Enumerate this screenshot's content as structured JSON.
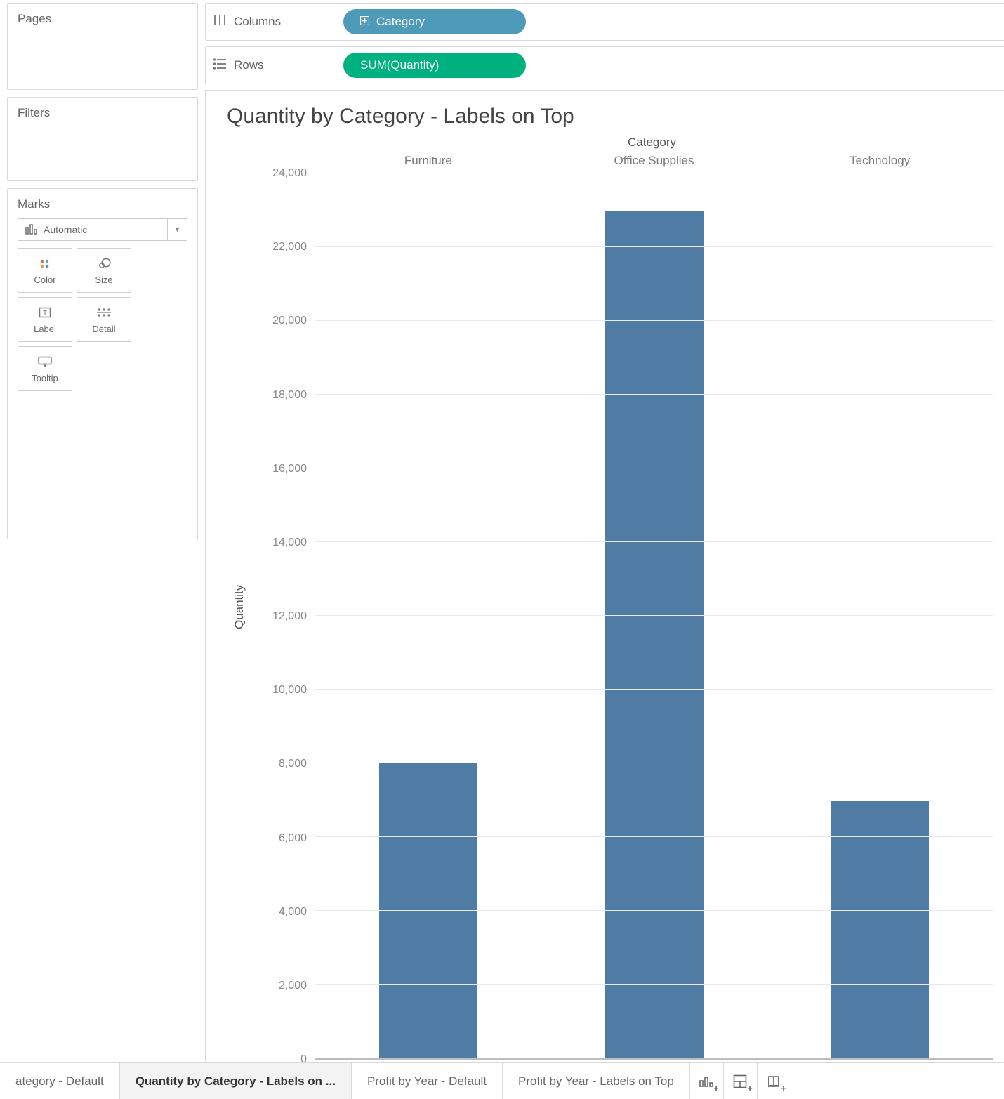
{
  "shelves": {
    "pages_label": "Pages",
    "filters_label": "Filters",
    "marks_label": "Marks",
    "columns_label": "Columns",
    "rows_label": "Rows"
  },
  "marks_card": {
    "dropdown_label": "Automatic",
    "buttons": {
      "color": "Color",
      "size": "Size",
      "label": "Label",
      "detail": "Detail",
      "tooltip": "Tooltip"
    }
  },
  "pills": {
    "columns": "Category",
    "rows": "SUM(Quantity)"
  },
  "viz": {
    "title": "Quantity by Category - Labels on Top",
    "x_dim_label": "Category",
    "y_measure_label": "Quantity"
  },
  "chart_data": {
    "type": "bar",
    "categories": [
      "Furniture",
      "Office Supplies",
      "Technology"
    ],
    "values": [
      8000,
      23000,
      7000
    ],
    "title": "Quantity by Category - Labels on Top",
    "xlabel": "Category",
    "ylabel": "Quantity",
    "ylim": [
      0,
      24000
    ],
    "yticks": [
      0,
      2000,
      4000,
      6000,
      8000,
      10000,
      12000,
      14000,
      16000,
      18000,
      20000,
      22000,
      24000
    ],
    "ytick_labels": [
      "0",
      "2,000",
      "4,000",
      "6,000",
      "8,000",
      "10,000",
      "12,000",
      "14,000",
      "16,000",
      "18,000",
      "20,000",
      "22,000",
      "24,000"
    ],
    "bar_color": "#4f7ca5"
  },
  "tabs": {
    "items": [
      {
        "label": "ategory - Default",
        "active": false
      },
      {
        "label": "Quantity by Category - Labels on ...",
        "active": true
      },
      {
        "label": "Profit by Year - Default",
        "active": false
      },
      {
        "label": "Profit by Year - Labels on Top",
        "active": false
      }
    ]
  }
}
